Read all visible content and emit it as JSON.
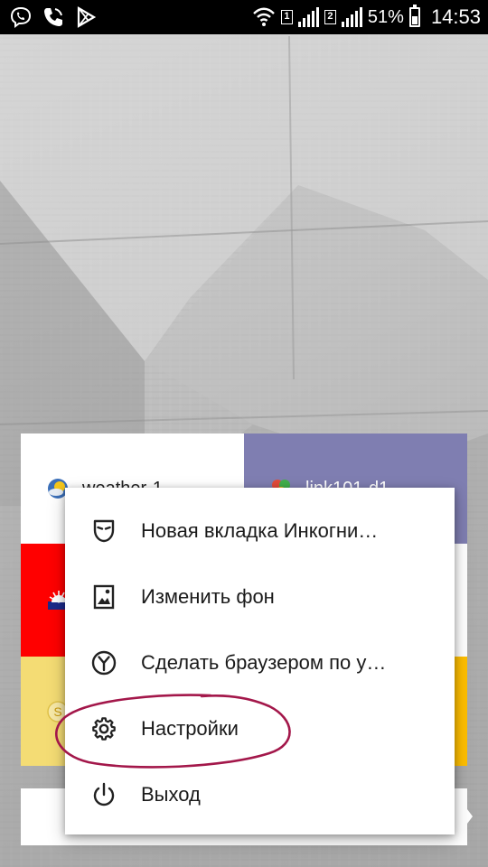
{
  "status_bar": {
    "left_icons": [
      "viber-icon",
      "phone-icon",
      "play-store-icon"
    ],
    "sim1_label": "1",
    "sim2_label": "2",
    "battery_text": "51%",
    "time": "14:53"
  },
  "tiles": [
    {
      "name": "tile-weather",
      "label": "weather-1",
      "bg": "#ffffff",
      "icon": "weather-icon"
    },
    {
      "name": "tile-purple",
      "label": "link101-d1",
      "bg": "#7f7eb1",
      "icon": "colorful-logo-icon"
    },
    {
      "name": "tile-red",
      "label": "",
      "bg": "#ff0000",
      "icon": "sun-logo-icon"
    },
    {
      "name": "tile-yellow",
      "label": "",
      "bg": "#f4dc74",
      "icon": "coin-icon"
    },
    {
      "name": "tile-orange",
      "label": "",
      "bg": "#ffbf00",
      "icon": ""
    }
  ],
  "menu": {
    "items": [
      {
        "icon": "incognito-mask-icon",
        "label": "Новая вкладка Инкогни…"
      },
      {
        "icon": "image-icon",
        "label": "Изменить фон"
      },
      {
        "icon": "yandex-browser-icon",
        "label": "Сделать браузером по у…"
      },
      {
        "icon": "gear-icon",
        "label": "Настройки"
      },
      {
        "icon": "power-icon",
        "label": "Выход"
      }
    ]
  },
  "colors": {
    "highlight": "#a3174a",
    "status_bar": "#000000",
    "menu_bg": "#ffffff"
  }
}
